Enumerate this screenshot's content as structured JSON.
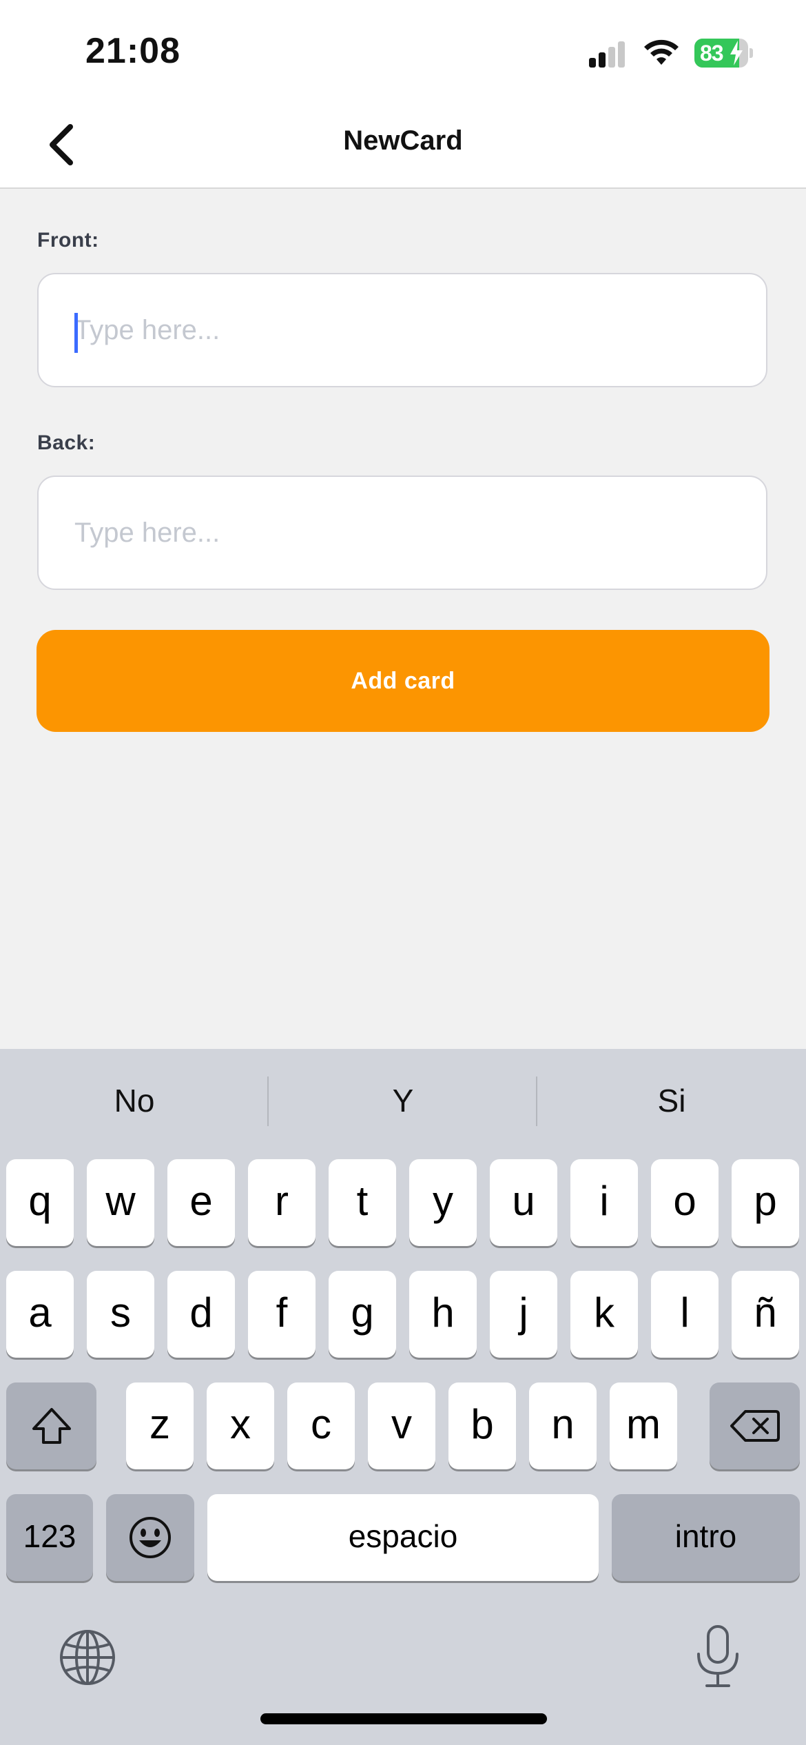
{
  "status_bar": {
    "time": "21:08",
    "battery_percent": "83",
    "battery_level": 0.83
  },
  "nav": {
    "title": "NewCard",
    "back_icon": "chevron-left-icon"
  },
  "form": {
    "front_label": "Front:",
    "front_placeholder": "Type here...",
    "back_label": "Back:",
    "back_placeholder": "Type here...",
    "submit_label": "Add card"
  },
  "colors": {
    "accent": "#fc9501",
    "caret": "#3b6bff",
    "battery": "#34c759"
  },
  "keyboard": {
    "suggestions": [
      "No",
      "Y",
      "Si"
    ],
    "row1": [
      "q",
      "w",
      "e",
      "r",
      "t",
      "y",
      "u",
      "i",
      "o",
      "p"
    ],
    "row2": [
      "a",
      "s",
      "d",
      "f",
      "g",
      "h",
      "j",
      "k",
      "l",
      "ñ"
    ],
    "row3": [
      "z",
      "x",
      "c",
      "v",
      "b",
      "n",
      "m"
    ],
    "numbers_label": "123",
    "space_label": "espacio",
    "return_label": "intro",
    "icons": [
      "shift-icon",
      "backspace-icon",
      "emoji-icon",
      "globe-icon",
      "microphone-icon"
    ]
  }
}
